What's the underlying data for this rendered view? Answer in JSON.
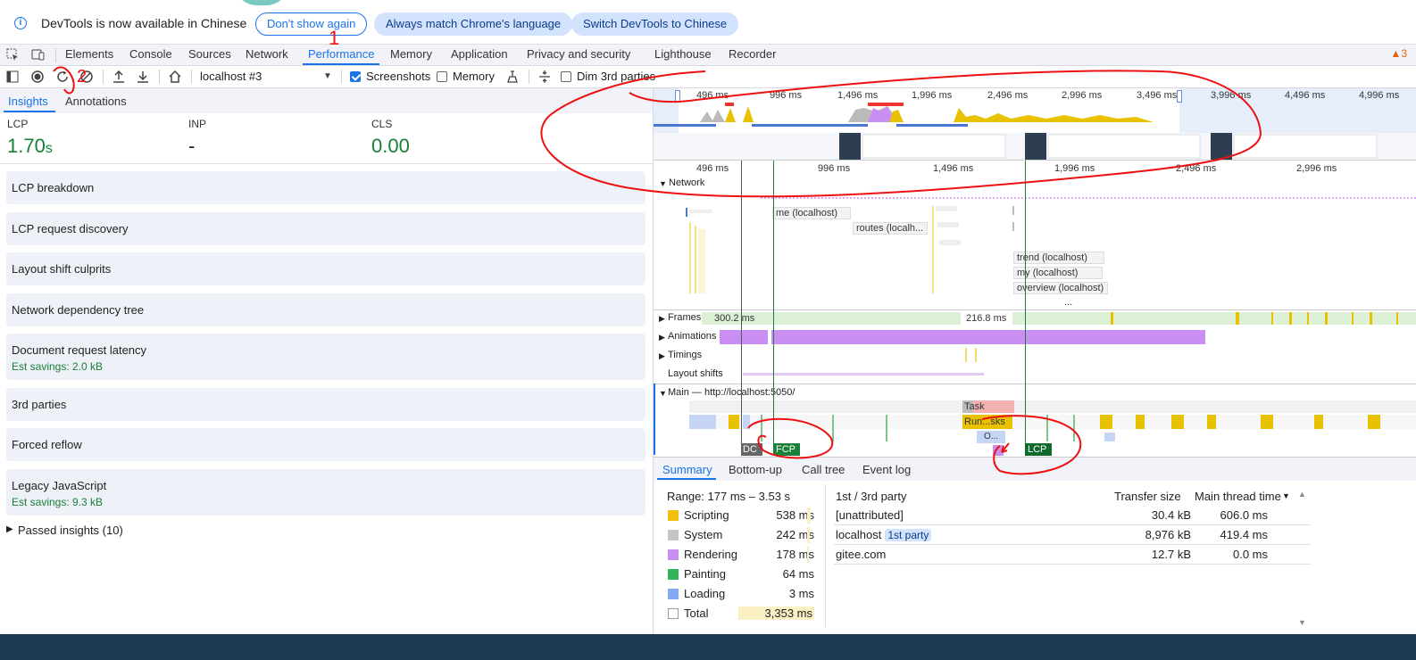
{
  "infobar": {
    "message": "DevTools is now available in Chinese",
    "dont_show": "Don't show again",
    "always_match": "Always match Chrome's language",
    "switch": "Switch DevTools to Chinese"
  },
  "tabs": [
    "Elements",
    "Console",
    "Sources",
    "Network",
    "Performance",
    "Memory",
    "Application",
    "Privacy and security",
    "Lighthouse",
    "Recorder"
  ],
  "active_tab": "Performance",
  "warning_count": "3",
  "toolbar": {
    "target": "localhost #3",
    "screenshots_label": "Screenshots",
    "screenshots_checked": true,
    "memory_label": "Memory",
    "memory_checked": false,
    "dim_label": "Dim 3rd parties",
    "dim_checked": false
  },
  "insights": {
    "tabs": [
      "Insights",
      "Annotations"
    ],
    "metrics": [
      {
        "label": "LCP",
        "value": "1.70",
        "unit": "s",
        "color": "#188038"
      },
      {
        "label": "INP",
        "value": "-",
        "unit": "",
        "color": "#1f1f1f"
      },
      {
        "label": "CLS",
        "value": "0.00",
        "unit": "",
        "color": "#188038"
      }
    ],
    "items": [
      {
        "title": "LCP breakdown",
        "sub": ""
      },
      {
        "title": "LCP request discovery",
        "sub": ""
      },
      {
        "title": "Layout shift culprits",
        "sub": ""
      },
      {
        "title": "Network dependency tree",
        "sub": ""
      },
      {
        "title": "Document request latency",
        "sub": "Est savings: 2.0 kB"
      },
      {
        "title": "3rd parties",
        "sub": ""
      },
      {
        "title": "Forced reflow",
        "sub": ""
      },
      {
        "title": "Legacy JavaScript",
        "sub": "Est savings: 9.3 kB"
      }
    ],
    "passed": "Passed insights (10)"
  },
  "timeline": {
    "overview_ticks": [
      "496 ms",
      "996 ms",
      "1,496 ms",
      "1,996 ms",
      "2,496 ms",
      "2,996 ms",
      "3,496 ms",
      "3,996 ms",
      "4,496 ms",
      "4,996 ms"
    ],
    "main_ticks": [
      "496 ms",
      "996 ms",
      "1,496 ms",
      "1,996 ms",
      "2,496 ms",
      "2,996 ms"
    ],
    "network_label": "Network",
    "requests": [
      "me (localhost)",
      "routes (localh...",
      "trend (localhost)",
      "my (localhost)",
      "overview (localhost)"
    ],
    "ellipsis": "...",
    "tracks": {
      "frames": "Frames",
      "animations": "Animations",
      "timings": "Timings",
      "layout_shifts": "Layout shifts",
      "main": "Main — http://localhost:5050/"
    },
    "frame_labels": [
      "300.2 ms",
      "216.8 ms"
    ],
    "task_label": "Task",
    "run_tasks": "Run...sks",
    "o_label": "O...",
    "markers": {
      "dcl": "DC",
      "fcp": "FCP",
      "lcp": "LCP"
    }
  },
  "annotations": {
    "n1": "1",
    "n2": "2"
  },
  "bottom": {
    "tabs": [
      "Summary",
      "Bottom-up",
      "Call tree",
      "Event log"
    ],
    "range": "Range: 177 ms – 3.53 s",
    "summary": [
      {
        "name": "Scripting",
        "value": "538 ms",
        "color": "#f2c10f"
      },
      {
        "name": "System",
        "value": "242 ms",
        "color": "#c5c5c5"
      },
      {
        "name": "Rendering",
        "value": "178 ms",
        "color": "#c98ef2"
      },
      {
        "name": "Painting",
        "value": "64 ms",
        "color": "#32b35a"
      },
      {
        "name": "Loading",
        "value": "3 ms",
        "color": "#85a9f0"
      },
      {
        "name": "Total",
        "value": "3,353 ms",
        "color": "#ffffff"
      }
    ],
    "party_headers": {
      "c1": "1st / 3rd party",
      "c2": "Transfer size",
      "c3": "Main thread time"
    },
    "parties": [
      {
        "name": "[unattributed]",
        "badge": "",
        "size": "30.4 kB",
        "time": "606.0 ms"
      },
      {
        "name": "localhost",
        "badge": "1st party",
        "size": "8,976 kB",
        "time": "419.4 ms"
      },
      {
        "name": "gitee.com",
        "badge": "",
        "size": "12.7 kB",
        "time": "0.0 ms"
      }
    ]
  }
}
